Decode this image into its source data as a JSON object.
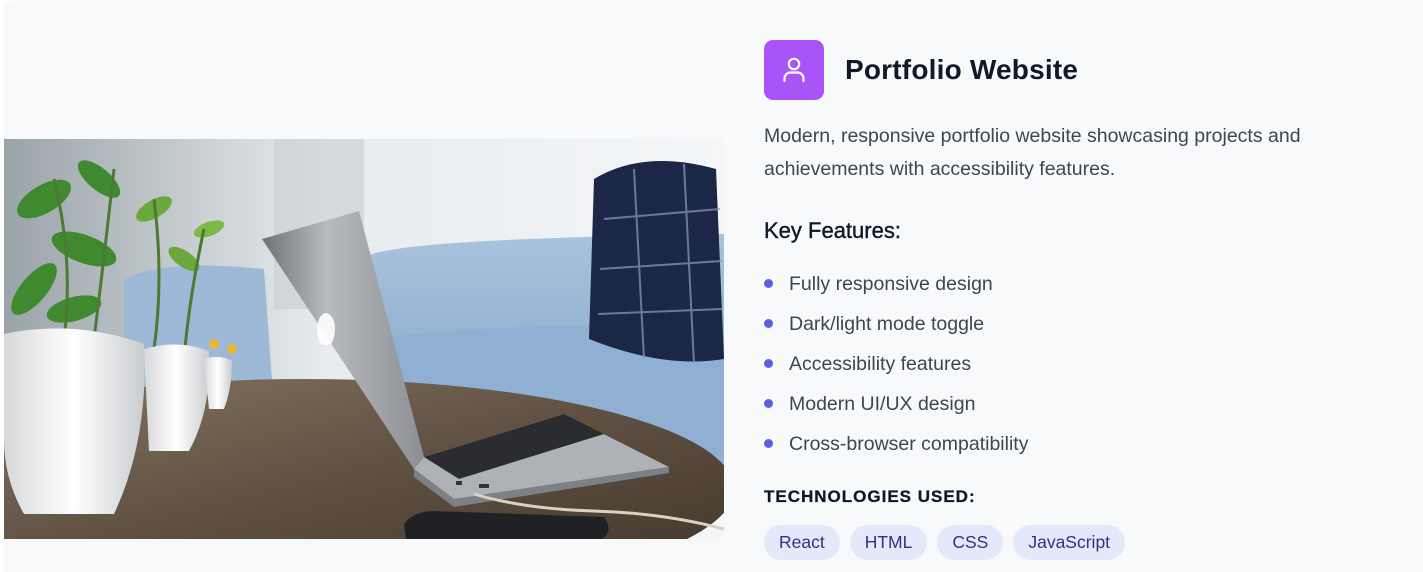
{
  "project": {
    "title": "Portfolio Website",
    "icon": "user-icon",
    "accent_color": "#a855f7",
    "description": "Modern, responsive portfolio website showcasing projects and achievements with accessibility features.",
    "image": "laptop-on-table-photo"
  },
  "features": {
    "heading": "Key Features:",
    "items": [
      "Fully responsive design",
      "Dark/light mode toggle",
      "Accessibility features",
      "Modern UI/UX design",
      "Cross-browser compatibility"
    ]
  },
  "technologies": {
    "heading": "TECHNOLOGIES USED:",
    "tags": [
      "React",
      "HTML",
      "CSS",
      "JavaScript"
    ]
  }
}
